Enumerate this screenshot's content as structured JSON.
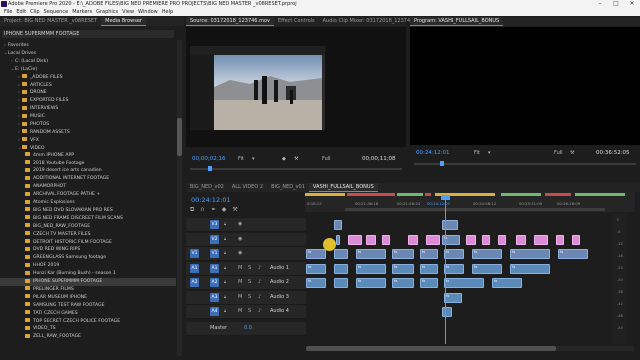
{
  "window": {
    "title": "Adobe Premiere Pro 2020 - E:\\_ADOBE FILES\\BIG NED PREMIERE PRO PROJECTS\\BIG NED MASTER _v08RESET.prproj"
  },
  "menu": [
    "File",
    "Edit",
    "Clip",
    "Sequence",
    "Markers",
    "Graphics",
    "View",
    "Window",
    "Help"
  ],
  "left_panel": {
    "tabs": [
      "Project: BIG NED MASTER _v08RESET",
      "Media Browser"
    ],
    "path": "IPHONE SUPERMMM FOOTAGE",
    "tree": [
      {
        "label": "Favorites",
        "indent": 0,
        "arrow": "›",
        "folder": false
      },
      {
        "label": "Local Drives",
        "indent": 0,
        "arrow": "⌄",
        "folder": false
      },
      {
        "label": "C: (Local Disk)",
        "indent": 1,
        "arrow": "›",
        "folder": false
      },
      {
        "label": "E: (LaCie)",
        "indent": 1,
        "arrow": "⌄",
        "folder": false
      },
      {
        "label": "_ADOBE FILES",
        "indent": 2,
        "arrow": "›",
        "folder": true
      },
      {
        "label": "ARTICLES",
        "indent": 2,
        "arrow": "›",
        "folder": true
      },
      {
        "label": "DRONE",
        "indent": 2,
        "arrow": "›",
        "folder": true
      },
      {
        "label": "EXPORTED FILES",
        "indent": 2,
        "arrow": "›",
        "folder": true
      },
      {
        "label": "INTERVIEWS",
        "indent": 2,
        "arrow": "›",
        "folder": true
      },
      {
        "label": "MUSIC",
        "indent": 2,
        "arrow": "›",
        "folder": true
      },
      {
        "label": "PHOTOS",
        "indent": 2,
        "arrow": "›",
        "folder": true
      },
      {
        "label": "RANDOM ASSETS",
        "indent": 2,
        "arrow": "›",
        "folder": true
      },
      {
        "label": "VFX",
        "indent": 2,
        "arrow": "›",
        "folder": true
      },
      {
        "label": "VIDEO",
        "indent": 2,
        "arrow": "⌄",
        "folder": true
      },
      {
        "label": "4mm IPHONE APP",
        "indent": 3,
        "arrow": "",
        "folder": true
      },
      {
        "label": "2018 Youtube Footage",
        "indent": 3,
        "arrow": "",
        "folder": true
      },
      {
        "label": "2019 desert ice arts canadien",
        "indent": 3,
        "arrow": "",
        "folder": true
      },
      {
        "label": "ADDITIONAL INTERNET FOOTAGE",
        "indent": 3,
        "arrow": "",
        "folder": true
      },
      {
        "label": "ANAMORPHOT",
        "indent": 3,
        "arrow": "",
        "folder": true
      },
      {
        "label": "ARCHIVAL FOOTAGE PATHE +",
        "indent": 3,
        "arrow": "",
        "folder": true
      },
      {
        "label": "Atomic Explosions",
        "indent": 3,
        "arrow": "",
        "folder": true
      },
      {
        "label": "BIG NED DVD SLOVAKIAN PRO RES",
        "indent": 3,
        "arrow": "",
        "folder": true
      },
      {
        "label": "BIG NED FRAME DISCREET FILM SCANS",
        "indent": 3,
        "arrow": "",
        "folder": true
      },
      {
        "label": "BIG_NED_RAW_FOOTAGE",
        "indent": 3,
        "arrow": "",
        "folder": true
      },
      {
        "label": "CZECH TV MASTER FILES",
        "indent": 3,
        "arrow": "",
        "folder": true
      },
      {
        "label": "DETROIT HISTORIC FILM FOOTAGE",
        "indent": 3,
        "arrow": "",
        "folder": true
      },
      {
        "label": "DVD RED WING RIPS",
        "indent": 3,
        "arrow": "",
        "folder": true
      },
      {
        "label": "GREENGLASS Samsung footage",
        "indent": 3,
        "arrow": "",
        "folder": true
      },
      {
        "label": "HHOF 2019",
        "indent": 3,
        "arrow": "",
        "folder": true
      },
      {
        "label": "Honzi Kar (Burning Bush) - season 1",
        "indent": 3,
        "arrow": "",
        "folder": true
      },
      {
        "label": "IPHONE SUPERMMM FOOTAGE",
        "indent": 3,
        "arrow": "",
        "folder": true,
        "selected": true
      },
      {
        "label": "PRELINGER FILMS",
        "indent": 3,
        "arrow": "",
        "folder": true
      },
      {
        "label": "PILAR MUSEUM IPHONE",
        "indent": 3,
        "arrow": "",
        "folder": true
      },
      {
        "label": "SAMSUNG TEST RAW FOOTAGE",
        "indent": 3,
        "arrow": "",
        "folder": true
      },
      {
        "label": "TATI CZECH GAMES",
        "indent": 3,
        "arrow": "",
        "folder": true
      },
      {
        "label": "TOP SECRET CZECH POLICE FOOTAGE",
        "indent": 3,
        "arrow": "",
        "folder": true
      },
      {
        "label": "VIDEO_TS",
        "indent": 3,
        "arrow": "",
        "folder": true
      },
      {
        "label": "ZELL_RAW_FOOTAGE",
        "indent": 3,
        "arrow": "",
        "folder": true
      }
    ]
  },
  "source_monitor": {
    "tabs": [
      "Source: 03172018_123746.mov",
      "Effect Controls",
      "Audio Clip Mixer: 03172018_123746"
    ],
    "timecode_in": "00;00;02;16",
    "fit": "Fit",
    "scale": "1/2",
    "quality": "Full",
    "timecode_dur": "00;00;11;08"
  },
  "program_monitor": {
    "tabs": [
      "Program: VASHI_FULLSAIL_BONUS"
    ],
    "timecode_in": "00:24:12:01",
    "fit": "Fit",
    "quality": "Full",
    "timecode_dur": "00:36:52:05"
  },
  "timeline": {
    "tabs": [
      "BIG_NED_v02",
      "ALL VIDEO 2",
      "BIG_NED_v01",
      "VASHI_FULLSAIL_BONUS"
    ],
    "timecode": "00:24:12:01",
    "ruler_ticks": [
      "0:18:12",
      "00:21:36:16",
      "00:21:56:24",
      "00:24:12:01",
      "00:24:58:12",
      "00:25:31:09",
      "00:26:18:09"
    ],
    "tracks": [
      {
        "id": "V3",
        "src": "",
        "label": "",
        "type": "video"
      },
      {
        "id": "V2",
        "src": "",
        "label": "",
        "type": "video"
      },
      {
        "id": "V1",
        "src": "V1",
        "label": "",
        "type": "video"
      },
      {
        "id": "A1",
        "src": "A1",
        "label": "Audio 1",
        "type": "audio"
      },
      {
        "id": "A2",
        "src": "A2",
        "label": "Audio 2",
        "type": "audio"
      },
      {
        "id": "A3",
        "src": "",
        "label": "Audio 3",
        "type": "audio"
      },
      {
        "id": "A4",
        "src": "",
        "label": "Audio 4",
        "type": "audio"
      }
    ],
    "master": {
      "label": "Master",
      "value": "0.0"
    },
    "clip_labels": [
      "fx"
    ],
    "meter_labels": [
      "0",
      "-6",
      "-12",
      "-18",
      "-24",
      "-30",
      "-36",
      "-42",
      "-48",
      "-54"
    ],
    "colors": {
      "video": "#6b88b4",
      "pink": "#d98bd6",
      "audio": "#5b89b8",
      "accent": "#4ea0ff"
    }
  }
}
